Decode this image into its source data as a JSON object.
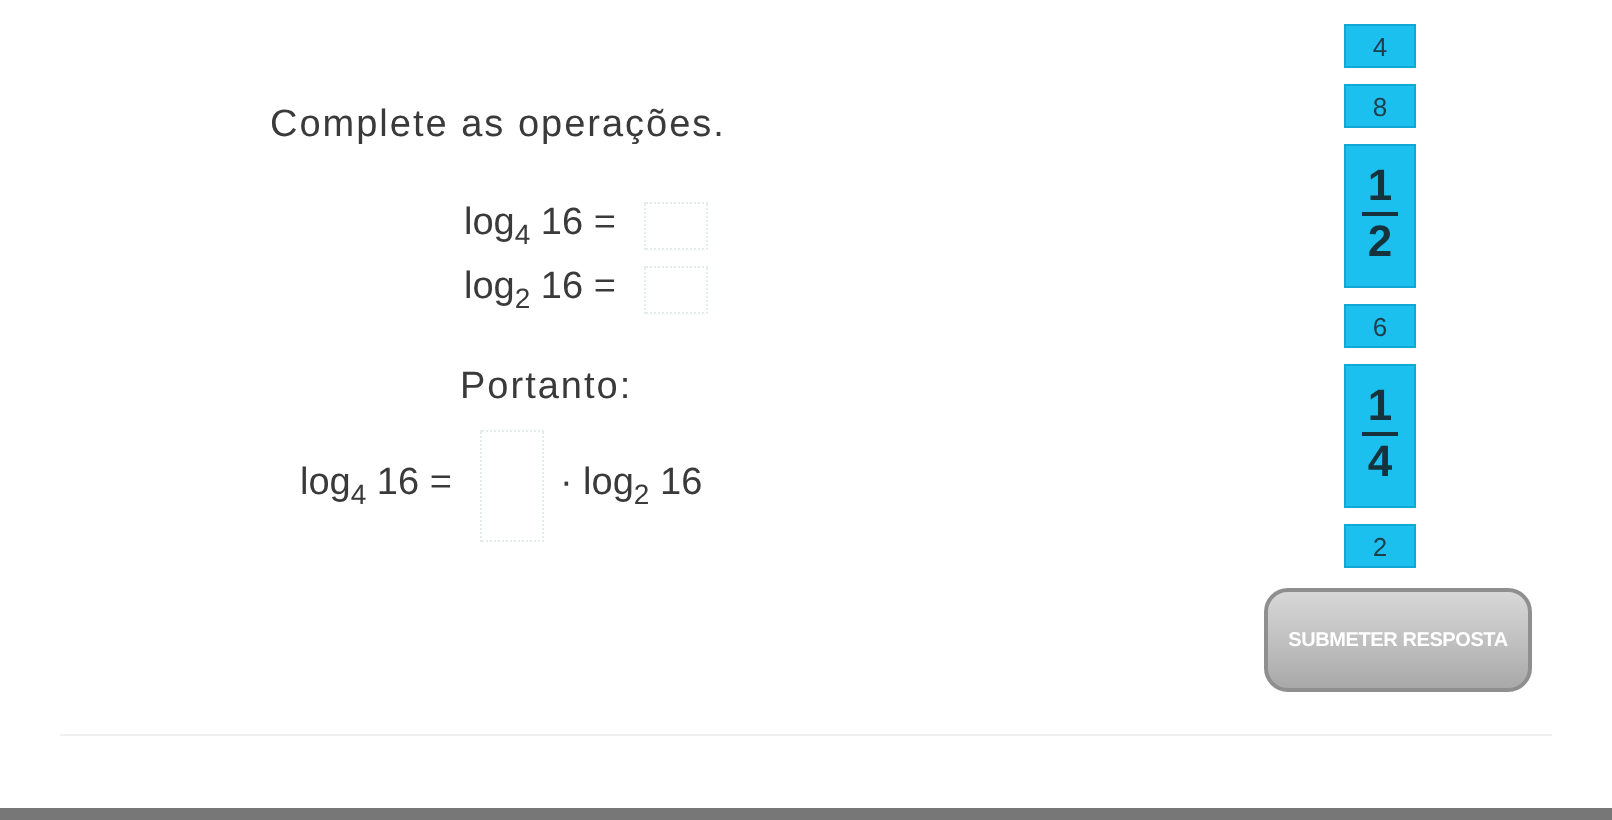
{
  "instruction": "Complete as operações.",
  "equations": [
    {
      "kind": "equation",
      "left": "log$_{4}$ 16 ="
    },
    {
      "kind": "equation",
      "left": "log$_{2}$ 16 ="
    },
    {
      "kind": "text",
      "text": "Portanto:"
    },
    {
      "kind": "equation",
      "left": "log$_{4}$ 16 =",
      "right": "· log$_{2}$ 16"
    }
  ],
  "tiles": [
    {
      "kind": "number",
      "text": "4"
    },
    {
      "kind": "number",
      "text": "8"
    },
    {
      "kind": "fraction",
      "numerator": "1",
      "denominator": "2"
    },
    {
      "kind": "number",
      "text": "6"
    },
    {
      "kind": "fraction",
      "numerator": "1",
      "denominator": "4"
    },
    {
      "kind": "number",
      "text": "2"
    }
  ],
  "submit_button": "SUBMETER RESPOSTA"
}
